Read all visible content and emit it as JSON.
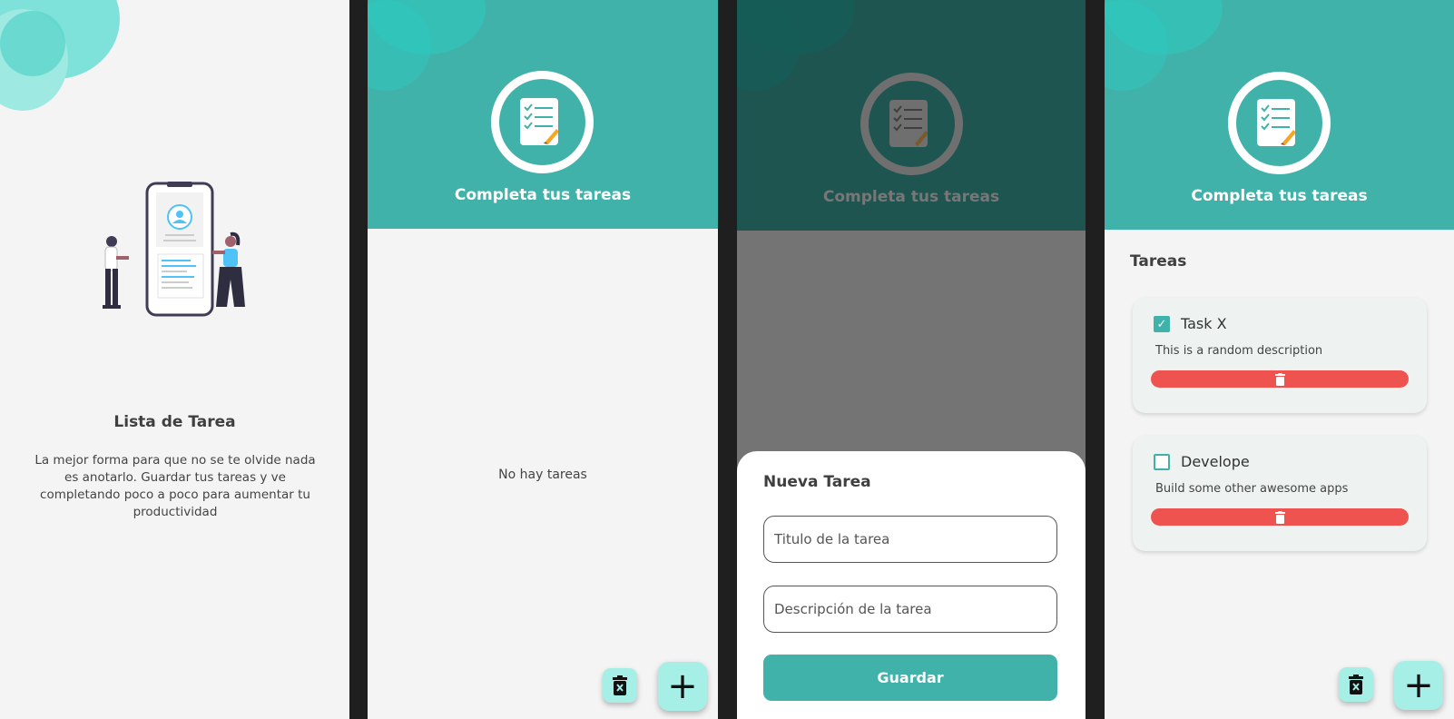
{
  "colors": {
    "primary": "#41b2a9",
    "accent_light": "#a5efe6",
    "danger": "#ef5350",
    "overlay_dark": "#1f5550"
  },
  "onboarding": {
    "title": "Lista de Tarea",
    "description": "La mejor forma para que no se te olvide nada es anotarlo. Guardar tus tareas y ve completando poco a poco para aumentar tu productividad"
  },
  "home": {
    "header_title": "Completa tus tareas",
    "empty_message": "No hay tareas"
  },
  "new_task_dialog": {
    "title": "Nueva Tarea",
    "title_placeholder": "Titulo de la tarea",
    "description_placeholder": "Descripción de la tarea",
    "save_label": "Guardar"
  },
  "task_list": {
    "section_title": "Tareas",
    "tasks": [
      {
        "title": "Task X",
        "description": "This is a random description",
        "done": true
      },
      {
        "title": "Develope",
        "description": "Build some other awesome apps",
        "done": false
      }
    ]
  },
  "icons": {
    "delete_all": "delete-sweep-icon",
    "add": "plus-icon",
    "delete": "trash-icon",
    "checklist": "checklist-document-icon"
  }
}
